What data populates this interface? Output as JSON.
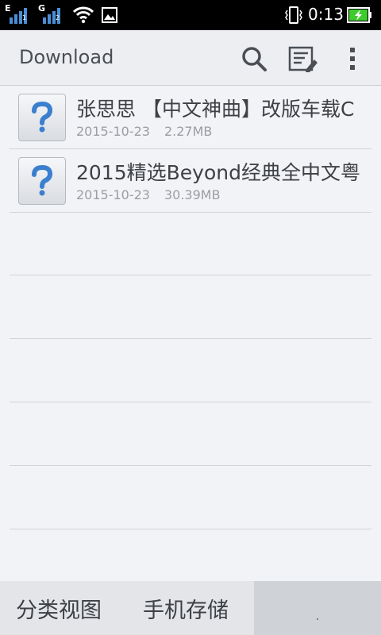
{
  "status_bar": {
    "sim1_network": "E",
    "sim1_slot": "1",
    "sim2_network": "G",
    "sim2_slot": "2",
    "time": "0:13",
    "icons": [
      "signal-icon",
      "signal-icon",
      "wifi-icon",
      "image-icon",
      "vibrate-icon",
      "battery-charging-icon"
    ]
  },
  "action_bar": {
    "title": "Download",
    "icons": [
      "search-icon",
      "edit-list-icon",
      "more-vert-icon"
    ]
  },
  "files": [
    {
      "name": "张思思 【中文神曲】改版车载C",
      "date": "2015-10-23",
      "size": "2.27MB",
      "icon": "unknown-file-icon"
    },
    {
      "name": "2015精选Beyond经典全中文粤",
      "date": "2015-10-23",
      "size": "30.39MB",
      "icon": "unknown-file-icon"
    }
  ],
  "bottom_tabs": {
    "category_view": "分类视图",
    "phone_storage": "手机存储",
    "extra": "."
  },
  "colors": {
    "accent_blue": "#4a8fd6",
    "battery_green": "#3ecb2e"
  }
}
